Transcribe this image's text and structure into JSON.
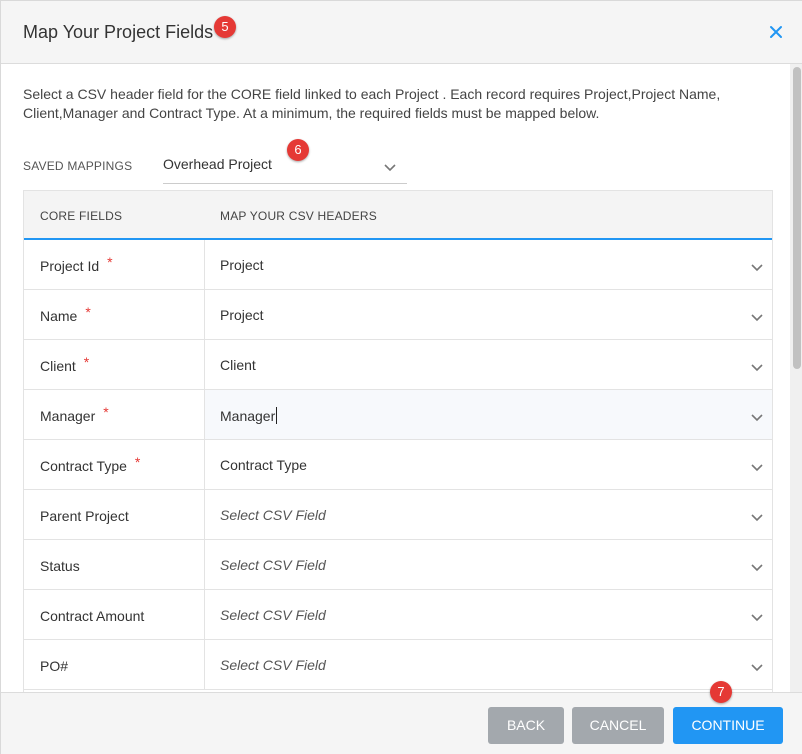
{
  "dialog": {
    "title": "Map Your Project Fields",
    "description": "Select a CSV header field for the CORE field linked to each Project . Each record requires Project,Project Name, Client,Manager and Contract Type. At a minimum, the required fields must be mapped below."
  },
  "annotations": {
    "badge_title": "5",
    "badge_saved": "6",
    "badge_continue": "7"
  },
  "saved_mappings": {
    "label": "SAVED MAPPINGS",
    "value": "Overhead Project"
  },
  "table": {
    "headers": {
      "core": "CORE FIELDS",
      "map": "MAP YOUR CSV HEADERS"
    },
    "rows": [
      {
        "field": "Project Id",
        "required": "*",
        "value": "Project"
      },
      {
        "field": "Name",
        "required": "*",
        "value": "Project"
      },
      {
        "field": "Client",
        "required": "*",
        "value": "Client"
      },
      {
        "field": "Manager",
        "required": "*",
        "value": "Manager"
      },
      {
        "field": "Contract Type",
        "required": "*",
        "value": "Contract Type"
      },
      {
        "field": "Parent Project",
        "value": "Select CSV Field"
      },
      {
        "field": "Status",
        "value": "Select CSV Field"
      },
      {
        "field": "Contract Amount",
        "value": "Select CSV Field"
      },
      {
        "field": "PO#",
        "value": "Select CSV Field"
      }
    ]
  },
  "buttons": {
    "back": "BACK",
    "cancel": "CANCEL",
    "continue": "CONTINUE"
  },
  "icons": {
    "close": "close-icon",
    "dropdown": "chevron-down-icon"
  },
  "colors": {
    "accent": "#2196f3",
    "badge": "#e53935",
    "secondary_button": "#a3a8ad",
    "required": "#e53935"
  }
}
